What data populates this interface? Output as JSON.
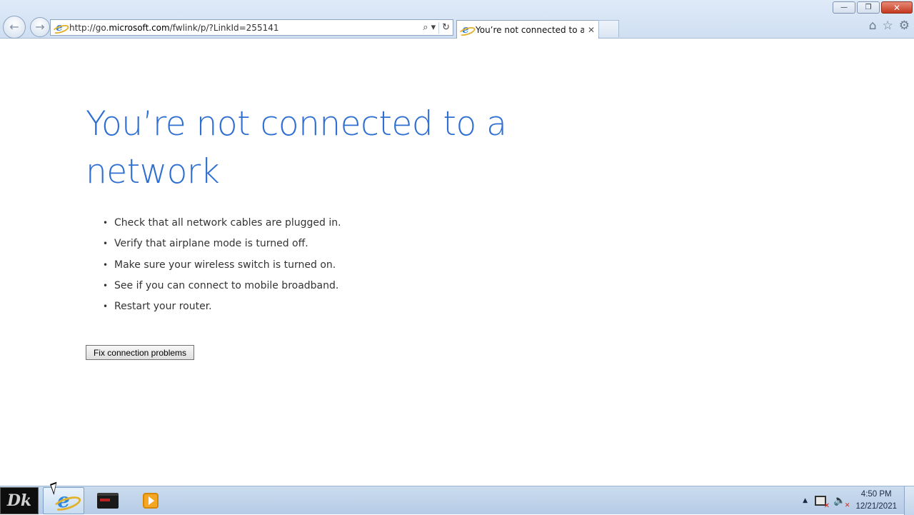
{
  "browser": {
    "address": {
      "prefix": "http://go.",
      "domain": "microsoft.com",
      "path": "/fwlink/p/?LinkId=255141"
    },
    "tab": {
      "title": "You’re not connected to a ...",
      "close_glyph": "✕"
    },
    "address_icons": {
      "search": "⌕",
      "dropdown": "▾",
      "refresh": "↻"
    },
    "nav": {
      "back": "←",
      "forward": "→"
    },
    "window_controls": {
      "minimize": "—",
      "restore": "❐",
      "close": "✕"
    },
    "command_icons": {
      "home": "⌂",
      "favorites": "☆",
      "tools": "⚙"
    }
  },
  "page": {
    "title": "You’re not connected to a network",
    "tips": [
      "Check that all network cables are plugged in.",
      "Verify that airplane mode is turned off.",
      "Make sure your wireless switch is turned on.",
      "See if you can connect to mobile broadband.",
      "Restart your router."
    ],
    "bullet": "•",
    "fix_button_label": "Fix connection problems"
  },
  "taskbar": {
    "start_label": "Dk",
    "ie_glyph": "e",
    "tray_arrow": "▲",
    "volume_glyph": "🔈",
    "time": "4:50 PM",
    "date": "12/21/2021"
  },
  "colors": {
    "title_blue": "#2f6fd1",
    "chrome_blue": "#cfdff2",
    "close_red": "#c4391f"
  }
}
